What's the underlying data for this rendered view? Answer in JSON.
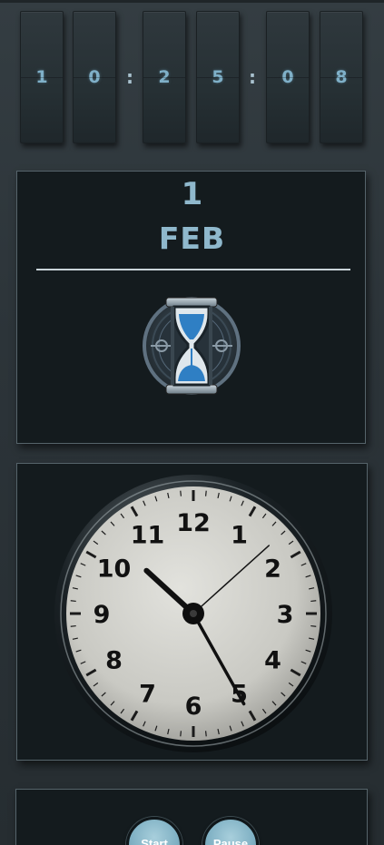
{
  "clock_digits": {
    "h1": "1",
    "h2": "0",
    "sep1": ":",
    "m1": "2",
    "m2": "5",
    "sep2": ":",
    "s1": "0",
    "s2": "8"
  },
  "date": {
    "day": "1",
    "month": "FEB"
  },
  "icons": {
    "timer": "hourglass-icon"
  },
  "analog_clock": {
    "numerals": [
      "12",
      "1",
      "2",
      "3",
      "4",
      "5",
      "6",
      "7",
      "8",
      "9",
      "10",
      "11"
    ],
    "time": {
      "hour": 10,
      "minute": 25,
      "second": 8
    }
  },
  "controls": {
    "start_label": "Start",
    "pause_label": "Pause"
  },
  "colors": {
    "accent": "#8fb8cc",
    "panel": "#141b1e",
    "background": "#2c3439"
  }
}
